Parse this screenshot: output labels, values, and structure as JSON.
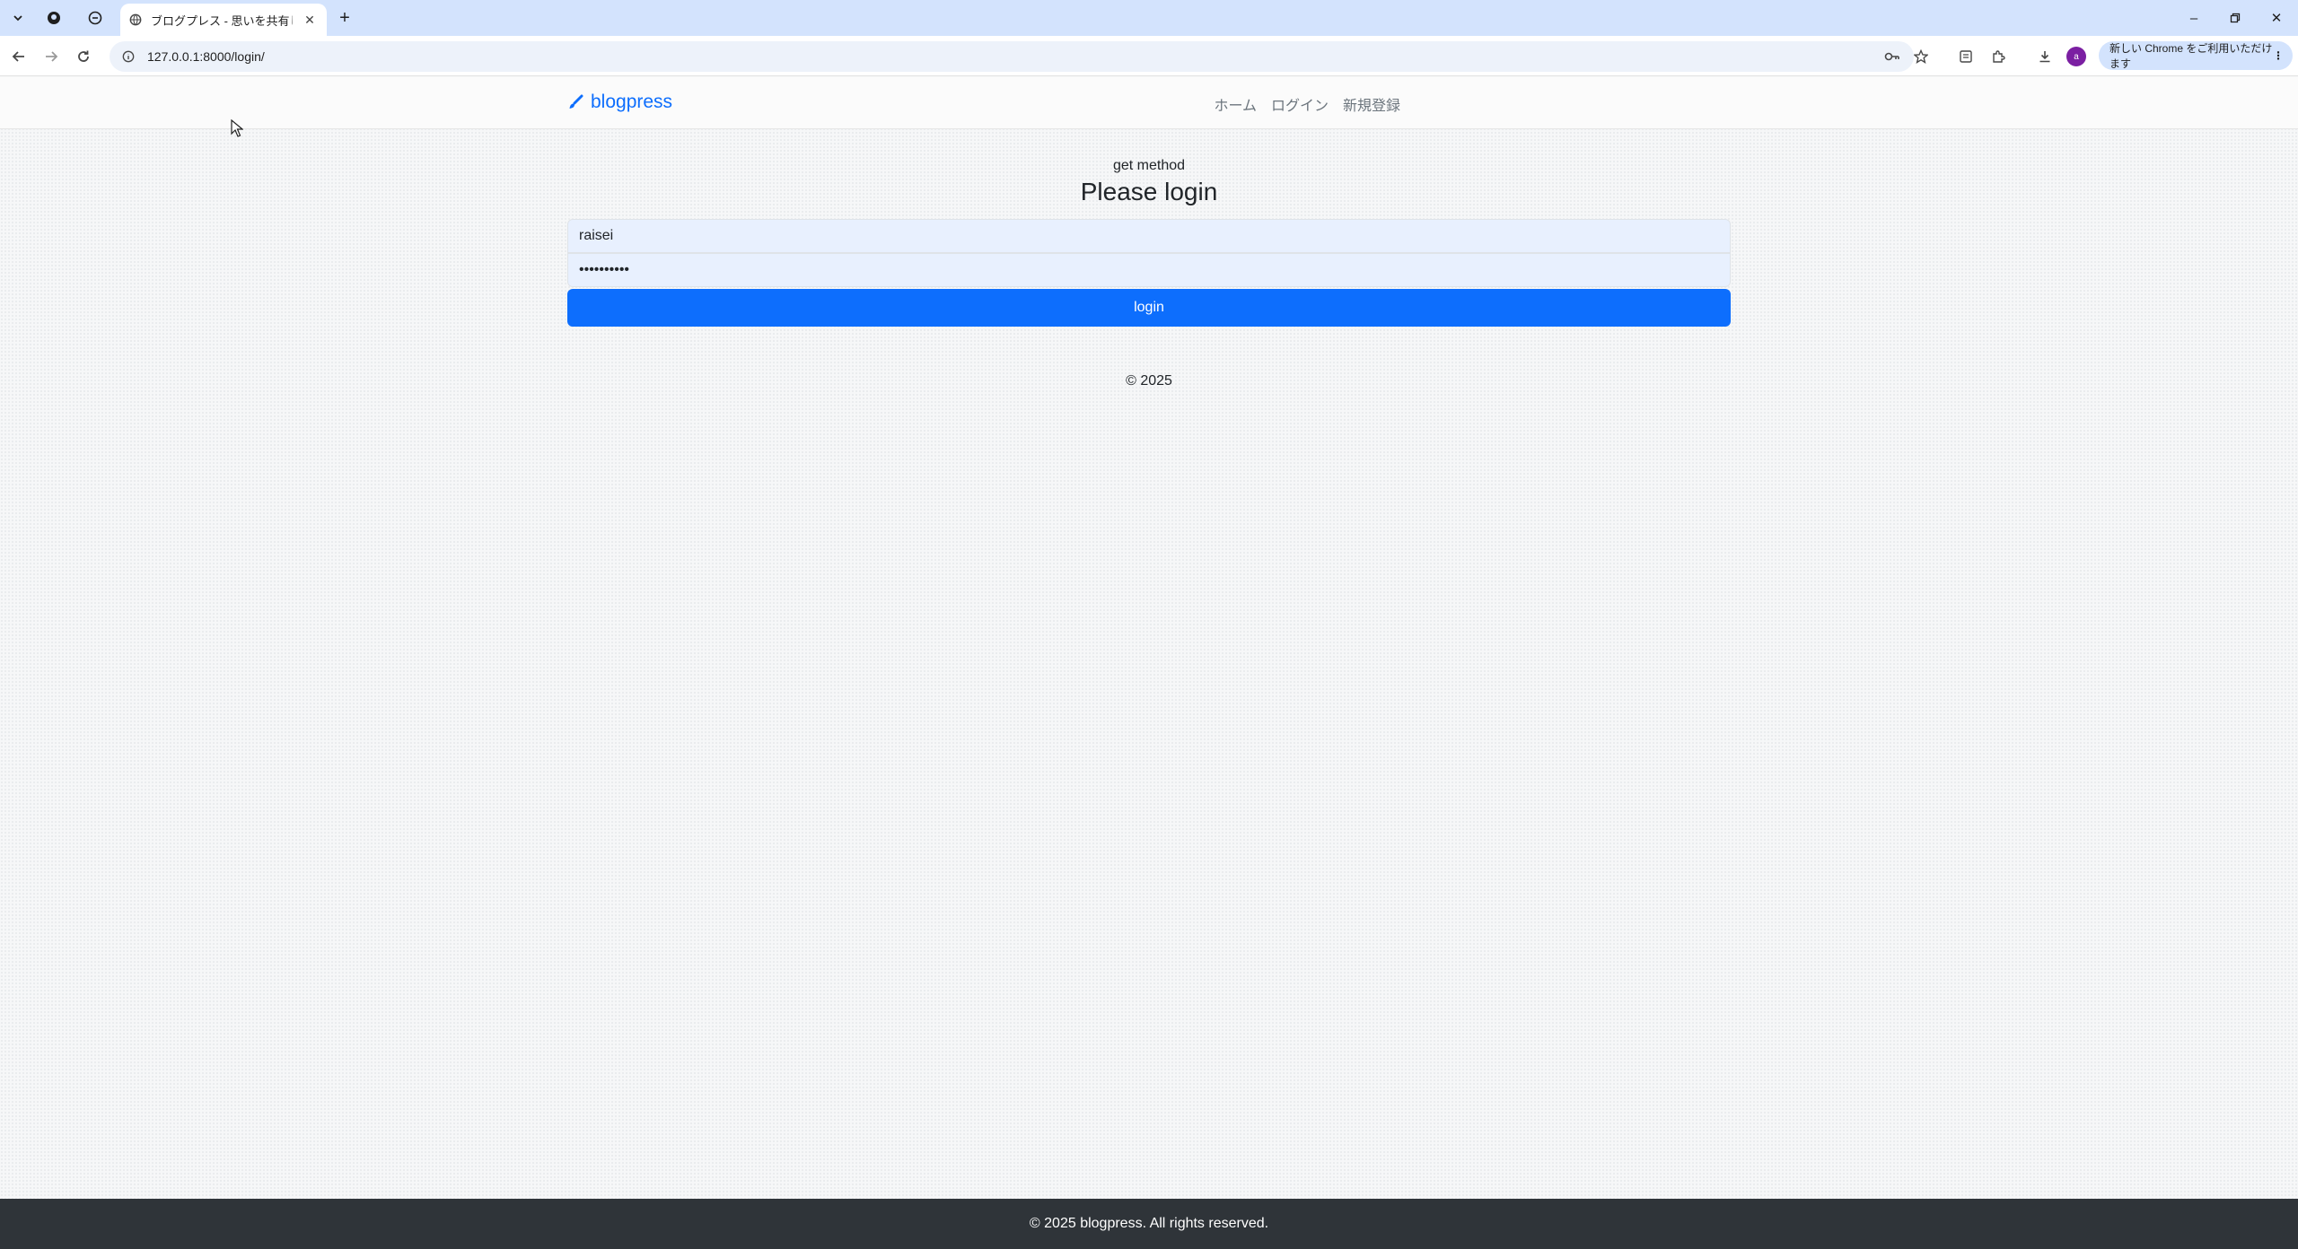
{
  "browser": {
    "tab_title": "ブログプレス - 思いを共有しよう",
    "url": "127.0.0.1:8000/login/",
    "promo_text": "新しい Chrome をご利用いただけます",
    "profile_initial": "a"
  },
  "site": {
    "brand": "blogpress",
    "nav": {
      "home": "ホーム",
      "login": "ログイン",
      "signup": "新規登録"
    }
  },
  "login": {
    "method_text": "get method",
    "heading": "Please login",
    "username_value": "raisei",
    "password_value": "••••••••••",
    "button_label": "login",
    "copyright": "© 2025"
  },
  "footer": {
    "text": "© 2025 blogpress. All rights reserved."
  },
  "colors": {
    "primary": "#0d6efd",
    "footer_bg": "#2f3439",
    "tabstrip": "#d3e3fd"
  }
}
